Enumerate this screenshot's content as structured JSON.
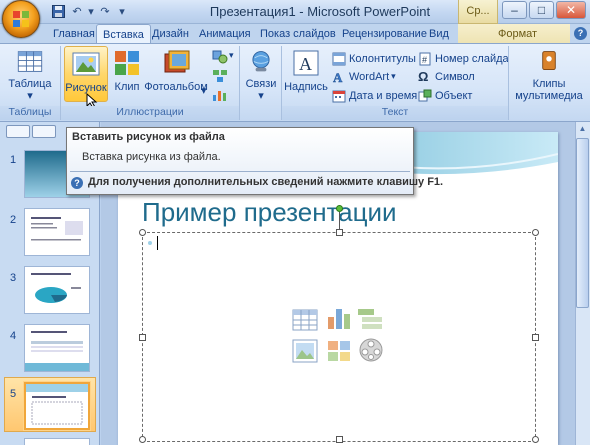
{
  "window": {
    "title": "Презентация1 - Microsoft PowerPoint",
    "contextual_tab": "Ср...",
    "minimize": "–",
    "maximize": "□",
    "close": "✕"
  },
  "qat": {
    "save_icon": "save-icon",
    "undo_icon": "undo-icon",
    "redo_icon": "redo-icon",
    "customize_icon": "dropdown-icon"
  },
  "tabs": [
    {
      "label": "Главная"
    },
    {
      "label": "Вставка",
      "active": true
    },
    {
      "label": "Дизайн"
    },
    {
      "label": "Анимация"
    },
    {
      "label": "Показ слайдов"
    },
    {
      "label": "Рецензирование"
    },
    {
      "label": "Вид"
    },
    {
      "label": "Формат",
      "contextual": true
    }
  ],
  "help_icon": "?",
  "ribbon": {
    "groups": {
      "tables": {
        "label": "Таблицы",
        "table_button": "Таблица"
      },
      "illustrations": {
        "label": "Иллюстрации",
        "picture": "Рисунок",
        "clip": "Клип",
        "album": "Фотоальбом",
        "links": "Связи"
      },
      "text": {
        "label": "Текст",
        "caption": "Надпись",
        "header_footer": "Колонтитулы",
        "wordart": "WordArt",
        "datetime": "Дата и время",
        "slide_number": "Номер слайда",
        "symbol": "Символ",
        "object": "Объект"
      },
      "media": {
        "clips_line1": "Клипы",
        "clips_line2": "мультимедиа"
      }
    },
    "dropdown_arrow": "▾",
    "symbol_glyph": "Ω"
  },
  "tooltip": {
    "title": "Вставить рисунок из файла",
    "body": "Вставка рисунка из файла.",
    "help": "Для получения дополнительных сведений нажмите клавишу F1."
  },
  "slides_panel": {
    "slide_numbers": [
      "1",
      "2",
      "3",
      "4",
      "5"
    ],
    "selected": 5
  },
  "slide": {
    "title": "Пример презентации"
  },
  "colors": {
    "accent_title": "#1f6b8c",
    "highlight": "#ffc83a",
    "ribbon_text": "#15428b"
  }
}
